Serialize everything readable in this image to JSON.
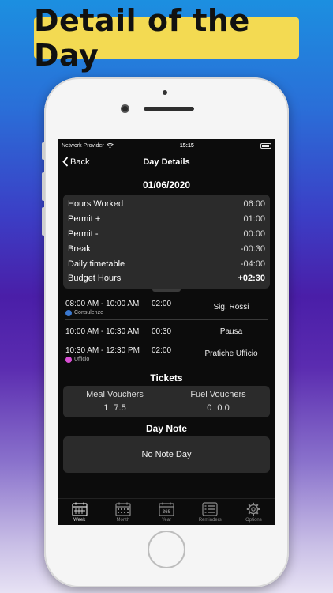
{
  "banner": {
    "title": "Detail of the Day"
  },
  "status": {
    "carrier": "Network Provider",
    "time": "15:15"
  },
  "nav": {
    "back": "Back",
    "title": "Day Details"
  },
  "date": "01/06/2020",
  "summary": [
    {
      "label": "Hours Worked",
      "value": "06:00"
    },
    {
      "label": "Permit +",
      "value": "01:00"
    },
    {
      "label": "Permit -",
      "value": "00:00"
    },
    {
      "label": "Break",
      "value": "-00:30"
    },
    {
      "label": "Daily timetable",
      "value": "-04:00"
    },
    {
      "label": "Budget Hours",
      "value": "+02:30"
    }
  ],
  "entries": [
    {
      "time": "08:00 AM - 10:00 AM",
      "duration": "02:00",
      "description": "Sig. Rossi",
      "category": "Consulenze",
      "category_color": "#3a78d0"
    },
    {
      "time": "10:00 AM - 10:30 AM",
      "duration": "00:30",
      "description": "Pausa",
      "category": "",
      "category_color": ""
    },
    {
      "time": "10:30 AM - 12:30 PM",
      "duration": "02:00",
      "description": "Pratiche Ufficio",
      "category": "Ufficio",
      "category_color": "#d94fd4"
    }
  ],
  "tickets": {
    "title": "Tickets",
    "meal": {
      "label": "Meal Vouchers",
      "count": "1",
      "amount": "7.5"
    },
    "fuel": {
      "label": "Fuel Vouchers",
      "count": "0",
      "amount": "0.0"
    }
  },
  "note": {
    "title": "Day Note",
    "text": "No Note Day"
  },
  "tabs": [
    {
      "label": "Week",
      "icon": "calendar-week-icon",
      "active": true
    },
    {
      "label": "Month",
      "icon": "calendar-month-icon",
      "active": false
    },
    {
      "label": "Year",
      "icon": "calendar-year-icon",
      "badge": "365",
      "active": false
    },
    {
      "label": "Reminders",
      "icon": "reminders-list-icon",
      "active": false
    },
    {
      "label": "Options",
      "icon": "gear-icon",
      "active": false
    }
  ]
}
